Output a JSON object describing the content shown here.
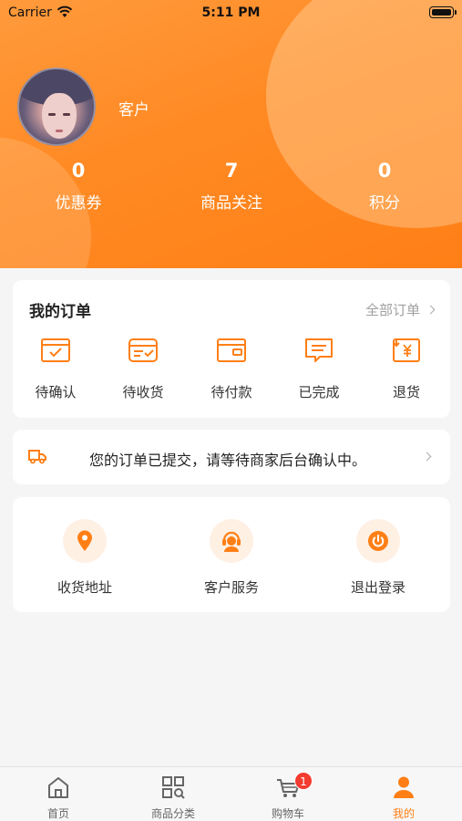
{
  "status_bar": {
    "carrier": "Carrier",
    "time": "5:11 PM"
  },
  "profile": {
    "username": "客户"
  },
  "stats": [
    {
      "value": "0",
      "label": "优惠券"
    },
    {
      "value": "7",
      "label": "商品关注"
    },
    {
      "value": "0",
      "label": "积分"
    }
  ],
  "orders": {
    "title": "我的订单",
    "all_label": "全部订单",
    "items": [
      {
        "label": "待确认",
        "icon": "pending-confirm-icon"
      },
      {
        "label": "待收货",
        "icon": "pending-receipt-icon"
      },
      {
        "label": "待付款",
        "icon": "pending-payment-icon"
      },
      {
        "label": "已完成",
        "icon": "completed-icon"
      },
      {
        "label": "退货",
        "icon": "refund-icon"
      }
    ]
  },
  "notice": {
    "text": "您的订单已提交，请等待商家后台确认中。",
    "icon": "truck-icon"
  },
  "services": [
    {
      "label": "收货地址",
      "icon": "location-pin-icon"
    },
    {
      "label": "客户服务",
      "icon": "customer-service-icon"
    },
    {
      "label": "退出登录",
      "icon": "power-icon"
    }
  ],
  "tabbar": {
    "items": [
      {
        "label": "首页",
        "icon": "home-icon"
      },
      {
        "label": "商品分类",
        "icon": "category-icon"
      },
      {
        "label": "购物车",
        "icon": "cart-icon",
        "badge": "1"
      },
      {
        "label": "我的",
        "icon": "profile-icon",
        "active": true
      }
    ]
  },
  "colors": {
    "accent": "#ff7f16",
    "badge": "#f33b2f",
    "background": "#f5f5f5"
  }
}
